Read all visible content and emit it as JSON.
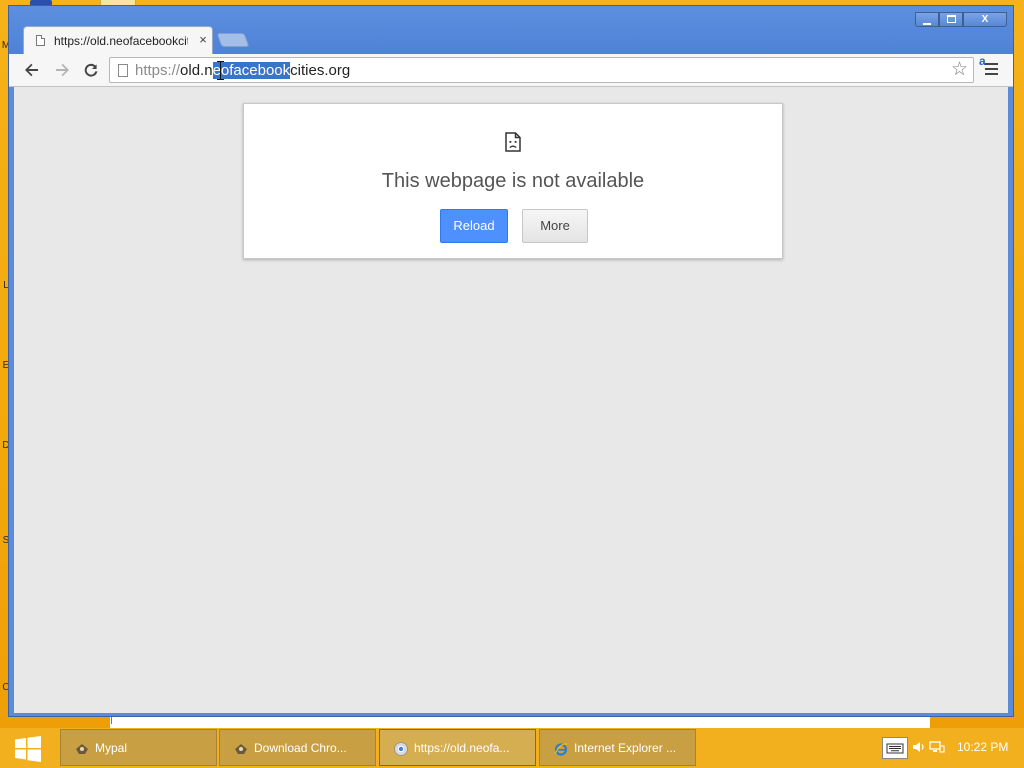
{
  "desktop": {
    "side_letters": [
      "M",
      "L",
      "E",
      "D",
      "S",
      "C"
    ]
  },
  "browser": {
    "tab": {
      "title": "https://old.neofacebookcities.org",
      "close_glyph": "×"
    },
    "window_controls": {
      "minimize": "minimize",
      "maximize": "maximize",
      "close": "X"
    },
    "toolbar": {
      "back_icon": "arrow-left-icon",
      "forward_icon": "arrow-right-icon",
      "reload_icon": "reload-icon",
      "star_glyph": "☆",
      "extension_badge": "a"
    },
    "omnibox": {
      "scheme": "https://",
      "host_pre": "old.n",
      "host_selected": "eofacebook",
      "host_post": "cities.org"
    }
  },
  "error_page": {
    "heading": "This webpage is not available",
    "reload_label": "Reload",
    "more_label": "More"
  },
  "taskbar": {
    "items": [
      {
        "label": "Mypal",
        "icon": "mypal-icon"
      },
      {
        "label": "Download Chro...",
        "icon": "mypal-icon"
      },
      {
        "label": "https://old.neofa...",
        "icon": "chrome-icon"
      },
      {
        "label": "Internet Explorer ...",
        "icon": "ie-icon"
      }
    ],
    "clock": "10:22 PM"
  },
  "colors": {
    "desktop_bg": "#f3ac0a",
    "chrome_frame": "#5c8bd9",
    "reload_button": "#4d90fe",
    "selection": "#3875c9"
  }
}
